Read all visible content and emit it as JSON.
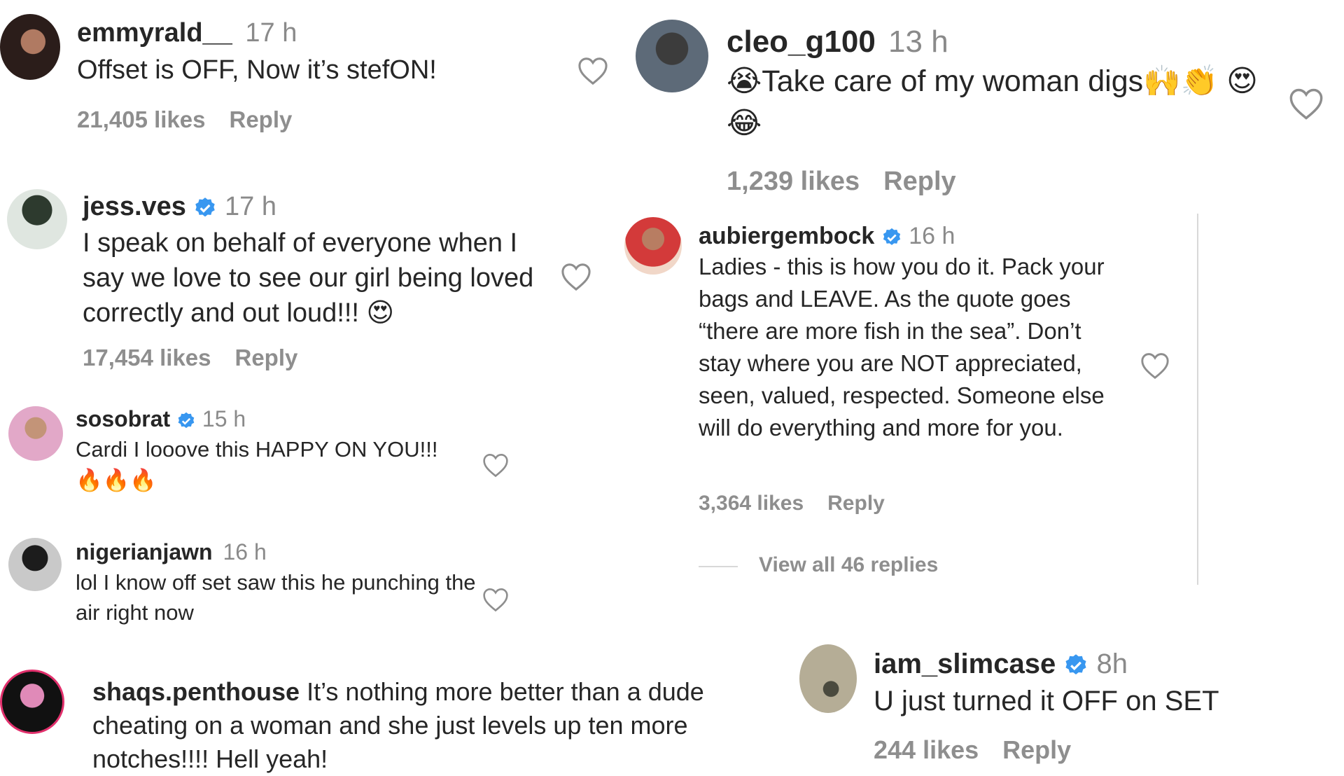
{
  "comments": [
    {
      "username": "emmyrald__",
      "verified": false,
      "time": "17 h",
      "text": "Offset is OFF, Now it’s stefON!",
      "likes": "21,405 likes",
      "reply": "Reply"
    },
    {
      "username": "jess.ves",
      "verified": true,
      "time": "17 h",
      "text": "I speak on behalf of everyone when I say we love to see our girl being loved correctly and out loud!!! 😍",
      "likes": "17,454 likes",
      "reply": "Reply"
    },
    {
      "username": "sosobrat",
      "verified": true,
      "time": "15 h",
      "text": "Cardi I looove this HAPPY ON YOU!!! 🔥🔥🔥"
    },
    {
      "username": "nigerianjawn",
      "verified": false,
      "time": "16 h",
      "text": "lol I know off set saw this he punching the air right now"
    },
    {
      "username": "shaqs.penthouse",
      "verified": false,
      "text": "It’s nothing more better than a dude cheating on a woman and she just levels up ten more notches!!!! Hell yeah!"
    },
    {
      "username": "cleo_g100",
      "verified": false,
      "time": "13 h",
      "text": "😭Take care of my woman digs🙌👏 😍😂",
      "likes": "1,239 likes",
      "reply": "Reply"
    },
    {
      "username": "aubiergembock",
      "verified": true,
      "time": "16 h",
      "text": "Ladies - this is how you do it. Pack your bags and LEAVE. As the quote goes “there are more fish in the sea”. Don’t stay where you are NOT appreciated, seen, valued, respected. Someone else will do everything and more for you.",
      "likes": "3,364 likes",
      "reply": "Reply",
      "view_replies": "View all 46 replies"
    },
    {
      "username": "iam_slimcase",
      "verified": true,
      "time": "8h",
      "text": "U just turned it OFF on SET",
      "likes": "244 likes",
      "reply": "Reply"
    }
  ],
  "colors": {
    "verified_blue": "#3897f0",
    "username": "#262626",
    "meta_gray": "#8e8e8e"
  },
  "icons": [
    "heart-icon",
    "verified-badge-icon"
  ]
}
